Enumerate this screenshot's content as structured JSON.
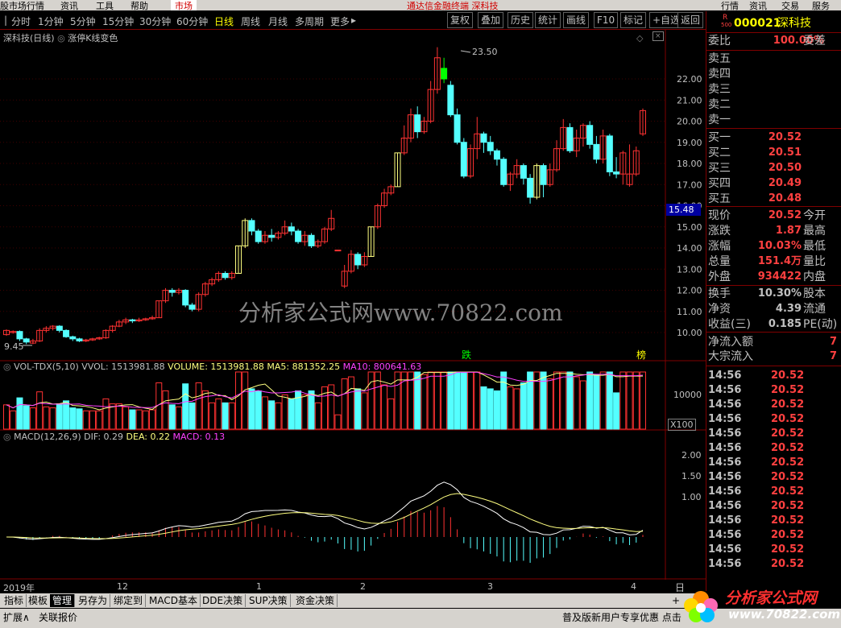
{
  "menubar": {
    "items": [
      "股市场行情",
      "资讯",
      "工具",
      "帮助"
    ],
    "market_btn": "市场",
    "app_title": "通达信金融终端 深科技",
    "right_buttons": [
      "行情",
      "资讯",
      "交易",
      "服务"
    ]
  },
  "toolbar": {
    "periods": [
      "分时",
      "1分钟",
      "5分钟",
      "15分钟",
      "30分钟",
      "60分钟",
      "日线",
      "周线",
      "月线",
      "多周期",
      "更多"
    ],
    "active": "日线",
    "more_arrow": "▸",
    "tools": [
      "复权",
      "叠加",
      "历史",
      "统计",
      "画线",
      "F10",
      "标记",
      "+自选",
      "返回"
    ]
  },
  "chart": {
    "title": "深科技(日线)",
    "formula": "涨停K线变色",
    "y_axis": [
      "22.00",
      "21.00",
      "20.00",
      "19.00",
      "18.00",
      "17.00",
      "16.00",
      "15.00",
      "14.00",
      "13.00",
      "12.00",
      "11.00",
      "10.00"
    ],
    "current_price_tag": "15.48",
    "high_label": "23.50",
    "low_label": "9.45",
    "marker_die": "跌",
    "marker_bang": "榜",
    "candles": [
      [
        9.9,
        10.1,
        9.85,
        10.15
      ],
      [
        10.0,
        10.05,
        9.95,
        10.1
      ],
      [
        10.05,
        9.7,
        9.6,
        10.1
      ],
      [
        9.7,
        9.55,
        9.45,
        9.75
      ],
      [
        9.5,
        9.6,
        9.45,
        9.7
      ],
      [
        9.6,
        10.1,
        9.55,
        10.2
      ],
      [
        10.1,
        10.2,
        10.0,
        10.3
      ],
      [
        10.2,
        10.3,
        10.1,
        10.35
      ],
      [
        10.3,
        10.1,
        10.0,
        10.35
      ],
      [
        10.1,
        9.8,
        9.75,
        10.15
      ],
      [
        9.8,
        9.7,
        9.6,
        9.85
      ],
      [
        9.7,
        9.6,
        9.55,
        9.75
      ],
      [
        9.6,
        9.65,
        9.55,
        9.7
      ],
      [
        9.65,
        9.7,
        9.6,
        9.75
      ],
      [
        9.7,
        9.75,
        9.65,
        9.8
      ],
      [
        9.75,
        10.1,
        9.7,
        10.15
      ],
      [
        10.1,
        10.3,
        10.0,
        10.35
      ],
      [
        10.3,
        10.5,
        10.25,
        10.6
      ],
      [
        10.5,
        10.6,
        10.4,
        10.7
      ],
      [
        10.6,
        10.55,
        10.45,
        10.65
      ],
      [
        10.55,
        10.6,
        10.5,
        10.7
      ],
      [
        10.6,
        10.65,
        10.55,
        10.7
      ],
      [
        10.65,
        10.7,
        10.6,
        10.8
      ],
      [
        10.7,
        11.5,
        10.7,
        11.5
      ],
      [
        11.5,
        12.0,
        11.4,
        12.1
      ],
      [
        12.0,
        11.9,
        11.7,
        12.1
      ],
      [
        11.9,
        12.0,
        11.8,
        12.1
      ],
      [
        12.0,
        11.3,
        11.2,
        12.05
      ],
      [
        11.3,
        11.1,
        11.0,
        11.4
      ],
      [
        11.1,
        11.8,
        11.0,
        11.9
      ],
      [
        11.8,
        12.3,
        11.7,
        12.4
      ],
      [
        12.3,
        12.5,
        12.2,
        12.6
      ],
      [
        12.5,
        12.8,
        12.4,
        12.9
      ],
      [
        12.8,
        12.6,
        12.5,
        12.9
      ],
      [
        12.6,
        12.8,
        12.5,
        12.9
      ],
      [
        12.8,
        14.1,
        12.8,
        14.1
      ],
      [
        14.1,
        15.3,
        14.0,
        15.4
      ],
      [
        15.3,
        14.8,
        14.6,
        15.4
      ],
      [
        14.8,
        14.3,
        14.2,
        14.9
      ],
      [
        14.3,
        14.6,
        14.2,
        14.8
      ],
      [
        14.6,
        14.5,
        14.3,
        14.9
      ],
      [
        14.5,
        14.7,
        14.4,
        14.8
      ],
      [
        14.7,
        15.0,
        14.6,
        15.3
      ],
      [
        15.0,
        14.8,
        14.6,
        15.2
      ],
      [
        14.8,
        14.3,
        14.2,
        14.9
      ],
      [
        14.3,
        14.6,
        14.1,
        14.8
      ],
      [
        14.6,
        14.1,
        14.0,
        14.7
      ],
      [
        14.1,
        14.3,
        14.0,
        14.4
      ],
      [
        14.3,
        14.9,
        14.2,
        15.0
      ],
      [
        14.9,
        15.4,
        14.8,
        15.8
      ],
      [
        13.9,
        13.9,
        13.9,
        13.9
      ],
      [
        12.2,
        12.9,
        12.1,
        13.2
      ],
      [
        12.9,
        13.7,
        12.8,
        13.9
      ],
      [
        13.7,
        13.2,
        13.0,
        13.8
      ],
      [
        13.2,
        13.6,
        13.1,
        13.8
      ],
      [
        13.6,
        15.0,
        13.6,
        15.0
      ],
      [
        15.0,
        16.0,
        14.9,
        16.1
      ],
      [
        16.0,
        16.6,
        15.9,
        16.8
      ],
      [
        16.6,
        16.9,
        16.5,
        17.0
      ],
      [
        16.9,
        18.5,
        16.9,
        18.5
      ],
      [
        18.5,
        19.2,
        18.4,
        19.8
      ],
      [
        19.2,
        20.3,
        19.0,
        20.6
      ],
      [
        20.3,
        19.5,
        19.2,
        20.7
      ],
      [
        19.5,
        20.0,
        19.4,
        20.2
      ],
      [
        20.0,
        21.5,
        19.9,
        21.9
      ],
      [
        21.5,
        23.0,
        21.3,
        23.5
      ],
      [
        22.0,
        22.5,
        21.8,
        23.0
      ],
      [
        21.7,
        20.3,
        20.2,
        21.9
      ],
      [
        20.3,
        19.0,
        18.9,
        20.6
      ],
      [
        19.0,
        17.4,
        17.3,
        19.2
      ],
      [
        17.4,
        18.7,
        17.3,
        18.9
      ],
      [
        18.7,
        19.4,
        18.2,
        20.2
      ],
      [
        19.4,
        19.0,
        18.5,
        19.5
      ],
      [
        19.0,
        18.6,
        18.4,
        19.3
      ],
      [
        18.6,
        18.2,
        17.9,
        18.7
      ],
      [
        18.2,
        17.0,
        16.9,
        18.3
      ],
      [
        17.0,
        17.5,
        16.7,
        17.6
      ],
      [
        17.5,
        17.9,
        17.3,
        18.2
      ],
      [
        17.9,
        17.3,
        17.0,
        18.0
      ],
      [
        17.3,
        16.4,
        16.1,
        17.5
      ],
      [
        16.4,
        17.9,
        16.3,
        18.0
      ],
      [
        17.9,
        17.0,
        16.4,
        18.0
      ],
      [
        17.0,
        17.7,
        16.9,
        18.0
      ],
      [
        17.7,
        18.7,
        17.6,
        19.1
      ],
      [
        18.7,
        19.7,
        18.6,
        20.1
      ],
      [
        19.7,
        18.6,
        18.5,
        19.9
      ],
      [
        18.6,
        19.2,
        18.3,
        19.6
      ],
      [
        19.2,
        19.8,
        18.8,
        19.9
      ],
      [
        19.8,
        18.9,
        18.7,
        20.0
      ],
      [
        18.9,
        18.2,
        18.0,
        19.3
      ],
      [
        18.2,
        19.3,
        18.0,
        19.6
      ],
      [
        19.3,
        17.6,
        17.4,
        19.4
      ],
      [
        17.6,
        17.5,
        17.3,
        18.3
      ],
      [
        17.5,
        18.5,
        17.0,
        18.6
      ],
      [
        17.0,
        17.5,
        16.9,
        18.9
      ],
      [
        17.5,
        18.6,
        17.4,
        18.8
      ],
      [
        19.4,
        20.5,
        19.3,
        20.6
      ]
    ],
    "vol_title": "VOL-TDX(5,10)",
    "vol_val": "VVOL: 1513981.88",
    "volume_val": "VOLUME: 1513981.88",
    "ma5": "MA5: 881352.25",
    "ma10": "MA10: 800641.63",
    "vol_axis": "10000",
    "vol_unit": "X100",
    "macd_title": "MACD(12,26,9)",
    "dif": "DIF: 0.29",
    "dea": "DEA: 0.22",
    "macd": "MACD: 0.13",
    "macd_axis": [
      "2.00",
      "1.50",
      "1.00"
    ],
    "date_labels": [
      "2019年",
      "12",
      "1",
      "2",
      "3",
      "4"
    ],
    "watermark": "分析家公式网www.70822.com"
  },
  "quote": {
    "code": "000021",
    "name": "深科技",
    "market_badge": "R",
    "market_badge_sub": "500",
    "weibi_label": "委比",
    "weibi_value": "100.00%",
    "weicha_label": "委差",
    "sell": [
      {
        "label": "卖五",
        "price": ""
      },
      {
        "label": "卖四",
        "price": ""
      },
      {
        "label": "卖三",
        "price": ""
      },
      {
        "label": "卖二",
        "price": ""
      },
      {
        "label": "卖一",
        "price": ""
      }
    ],
    "buy": [
      {
        "label": "买一",
        "price": "20.52"
      },
      {
        "label": "买二",
        "price": "20.51"
      },
      {
        "label": "买三",
        "price": "20.50"
      },
      {
        "label": "买四",
        "price": "20.49"
      },
      {
        "label": "买五",
        "price": "20.48"
      }
    ],
    "stats": [
      {
        "l": "现价",
        "v": "20.52",
        "r": "今开"
      },
      {
        "l": "涨跌",
        "v": "1.87",
        "r": "最高"
      },
      {
        "l": "涨幅",
        "v": "10.03%",
        "r": "最低"
      },
      {
        "l": "总量",
        "v": "151.4万",
        "r": "量比"
      },
      {
        "l": "外盘",
        "v": "934422",
        "r": "内盘"
      }
    ],
    "stats2": [
      {
        "l": "换手",
        "v": "10.30%",
        "r": "股本"
      },
      {
        "l": "净资",
        "v": "4.39",
        "r": "流通"
      },
      {
        "l": "收益(三)",
        "v": "0.185",
        "r": "PE(动)"
      }
    ],
    "flow": [
      {
        "l": "净流入额",
        "v": "7"
      },
      {
        "l": "大宗流入",
        "v": "7"
      }
    ],
    "ticks": [
      {
        "t": "14:56",
        "p": "20.52"
      },
      {
        "t": "14:56",
        "p": "20.52"
      },
      {
        "t": "14:56",
        "p": "20.52"
      },
      {
        "t": "14:56",
        "p": "20.52"
      },
      {
        "t": "14:56",
        "p": "20.52"
      },
      {
        "t": "14:56",
        "p": "20.52"
      },
      {
        "t": "14:56",
        "p": "20.52"
      },
      {
        "t": "14:56",
        "p": "20.52"
      },
      {
        "t": "14:56",
        "p": "20.52"
      },
      {
        "t": "14:56",
        "p": "20.52"
      },
      {
        "t": "14:56",
        "p": "20.52"
      },
      {
        "t": "14:56",
        "p": "20.52"
      },
      {
        "t": "14:56",
        "p": "20.52"
      },
      {
        "t": "14:56",
        "p": "20.52"
      }
    ]
  },
  "bottom_tabs": [
    "指标",
    "模板",
    "管理",
    "另存为",
    "绑定到",
    "MACD基本",
    "DDE决策",
    "SUP决策",
    "资金决策"
  ],
  "active_tab": "管理",
  "statusbar": {
    "left": [
      "扩展∧",
      "关联报价"
    ],
    "right": "普及版新用户专享优惠 点击",
    "side": "日",
    "plus": "+"
  },
  "logo": {
    "text": "分析家公式网",
    "url": "www.70822.com"
  }
}
